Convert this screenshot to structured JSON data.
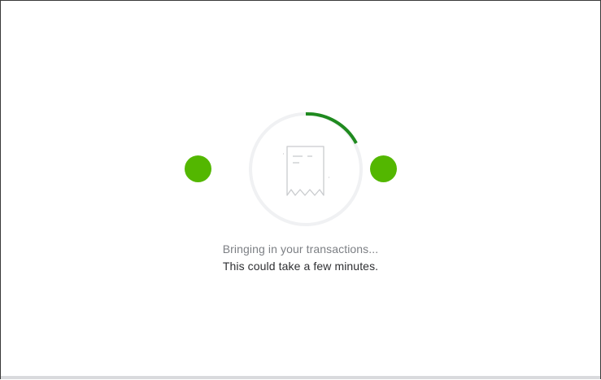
{
  "loading": {
    "message_primary": "Bringing in your transactions...",
    "message_secondary": "This could take a few minutes.",
    "progress_icon": "spinner-ring-icon",
    "document_icon": "receipt-icon",
    "indicator_icon": "green-dot-icon"
  },
  "colors": {
    "accent_green": "#53b700",
    "spinner_arc": "#1f8a1f",
    "ring_track": "#f0f1f3",
    "icon_stroke": "#c9cbce",
    "frame_border": "#3a3a3a",
    "bottom_strip": "#d9dadd"
  }
}
